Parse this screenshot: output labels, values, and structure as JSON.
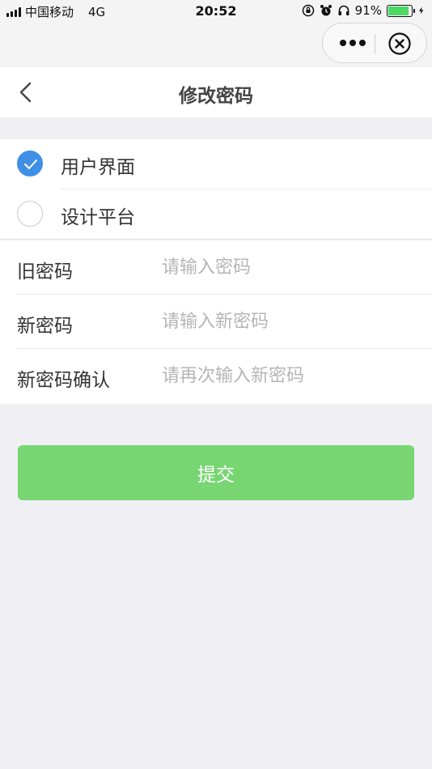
{
  "status_bar": {
    "carrier": "中国移动",
    "network": "4G",
    "time": "20:52",
    "battery": "91%",
    "battery_level": 0.91,
    "icons": [
      "signal-icon",
      "rotation-lock-icon",
      "alarm-icon",
      "headphones-icon",
      "battery-icon",
      "charging-bolt-icon"
    ]
  },
  "capsule": {
    "more_icon": "more-dots-icon",
    "close_icon": "circle-close-icon"
  },
  "nav": {
    "title": "修改密码",
    "back_icon": "chevron-left-icon"
  },
  "radio_options": [
    {
      "label": "用户界面",
      "checked": true
    },
    {
      "label": "设计平台",
      "checked": false
    }
  ],
  "fields": [
    {
      "label": "旧密码",
      "placeholder": "请输入密码",
      "value": ""
    },
    {
      "label": "新密码",
      "placeholder": "请输入新密码",
      "value": ""
    },
    {
      "label": "新密码确认",
      "placeholder": "请再次输入新密码",
      "value": ""
    }
  ],
  "submit": {
    "label": "提交"
  },
  "colors": {
    "accent_blue": "#3f8fe6",
    "submit_green": "#77d672",
    "page_bg": "#efeff4",
    "battery_green": "#4cd964"
  }
}
